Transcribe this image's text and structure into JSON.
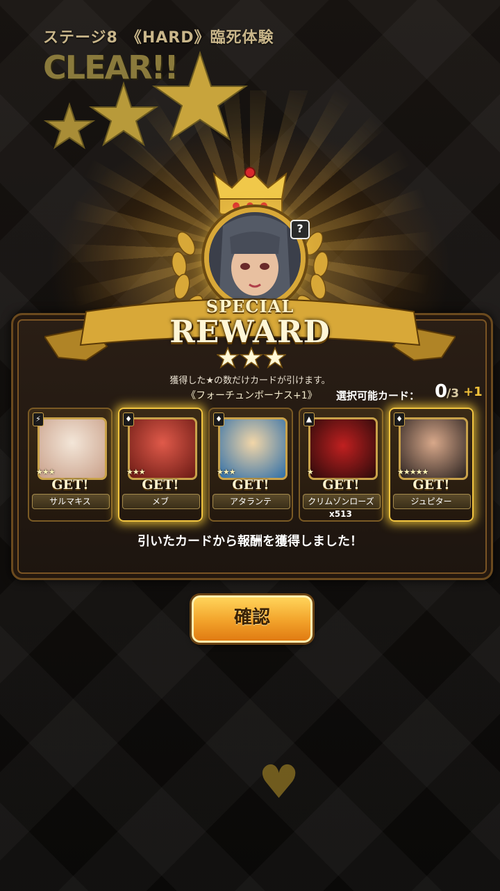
{
  "stage": {
    "title": "ステージ8　《HARD》臨死体験",
    "clear": "CLEAR!!",
    "stars_earned": 3
  },
  "reward": {
    "special": "SPECIAL",
    "reward": "REWARD",
    "rank_stars": 3,
    "help": "?",
    "description": "獲得した★の数だけカードが引けます。",
    "bonus": "《フォーチュンボーナス+1》",
    "select_label": "選択可能カード：",
    "select_current": "0",
    "select_total": "/3",
    "select_bonus": "+1"
  },
  "cards": [
    {
      "name": "サルマキス",
      "get": "GET!",
      "stars": "★★★",
      "quantity": "",
      "glow": false,
      "element": "⚡"
    },
    {
      "name": "メブ",
      "get": "GET!",
      "stars": "★★★",
      "quantity": "",
      "glow": true,
      "element": "♦"
    },
    {
      "name": "アタランテ",
      "get": "GET!",
      "stars": "★★★",
      "quantity": "",
      "glow": false,
      "element": "♦"
    },
    {
      "name": "クリムゾンローズ",
      "get": "GET!",
      "stars": "★",
      "quantity": "x513",
      "glow": false,
      "element": "▲"
    },
    {
      "name": "ジュピター",
      "get": "GET!",
      "stars": "★★★★★",
      "quantity": "",
      "glow": true,
      "element": "♦"
    }
  ],
  "result_message": "引いたカードから報酬を獲得しました！",
  "confirm_button": "確認",
  "colors": {
    "gold": "#e9b63c",
    "button": "#f2a22a",
    "panel": "#231810"
  }
}
